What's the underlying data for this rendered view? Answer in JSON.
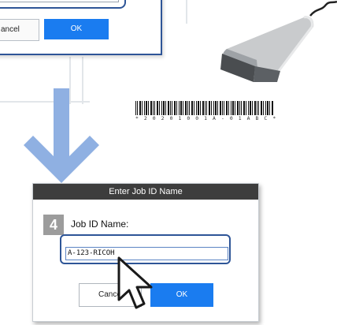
{
  "top_dialog": {
    "cancel_label": "ancel",
    "ok_label": "OK"
  },
  "barcode": {
    "text": "* 2 0 2 0 1 0 0 1 A - 0 1 A B C *"
  },
  "dialog": {
    "title": "Enter Job ID Name",
    "step_number": "4",
    "field_label": "Job ID Name:",
    "field_value": "A-123-RICOH",
    "cancel_label": "Cancel",
    "ok_label": "OK"
  },
  "colors": {
    "accent_blue": "#1a7cf0",
    "highlight_blue": "#2e5597",
    "arrow_blue": "#8fb0e2",
    "title_bar": "#3d3d3d"
  }
}
